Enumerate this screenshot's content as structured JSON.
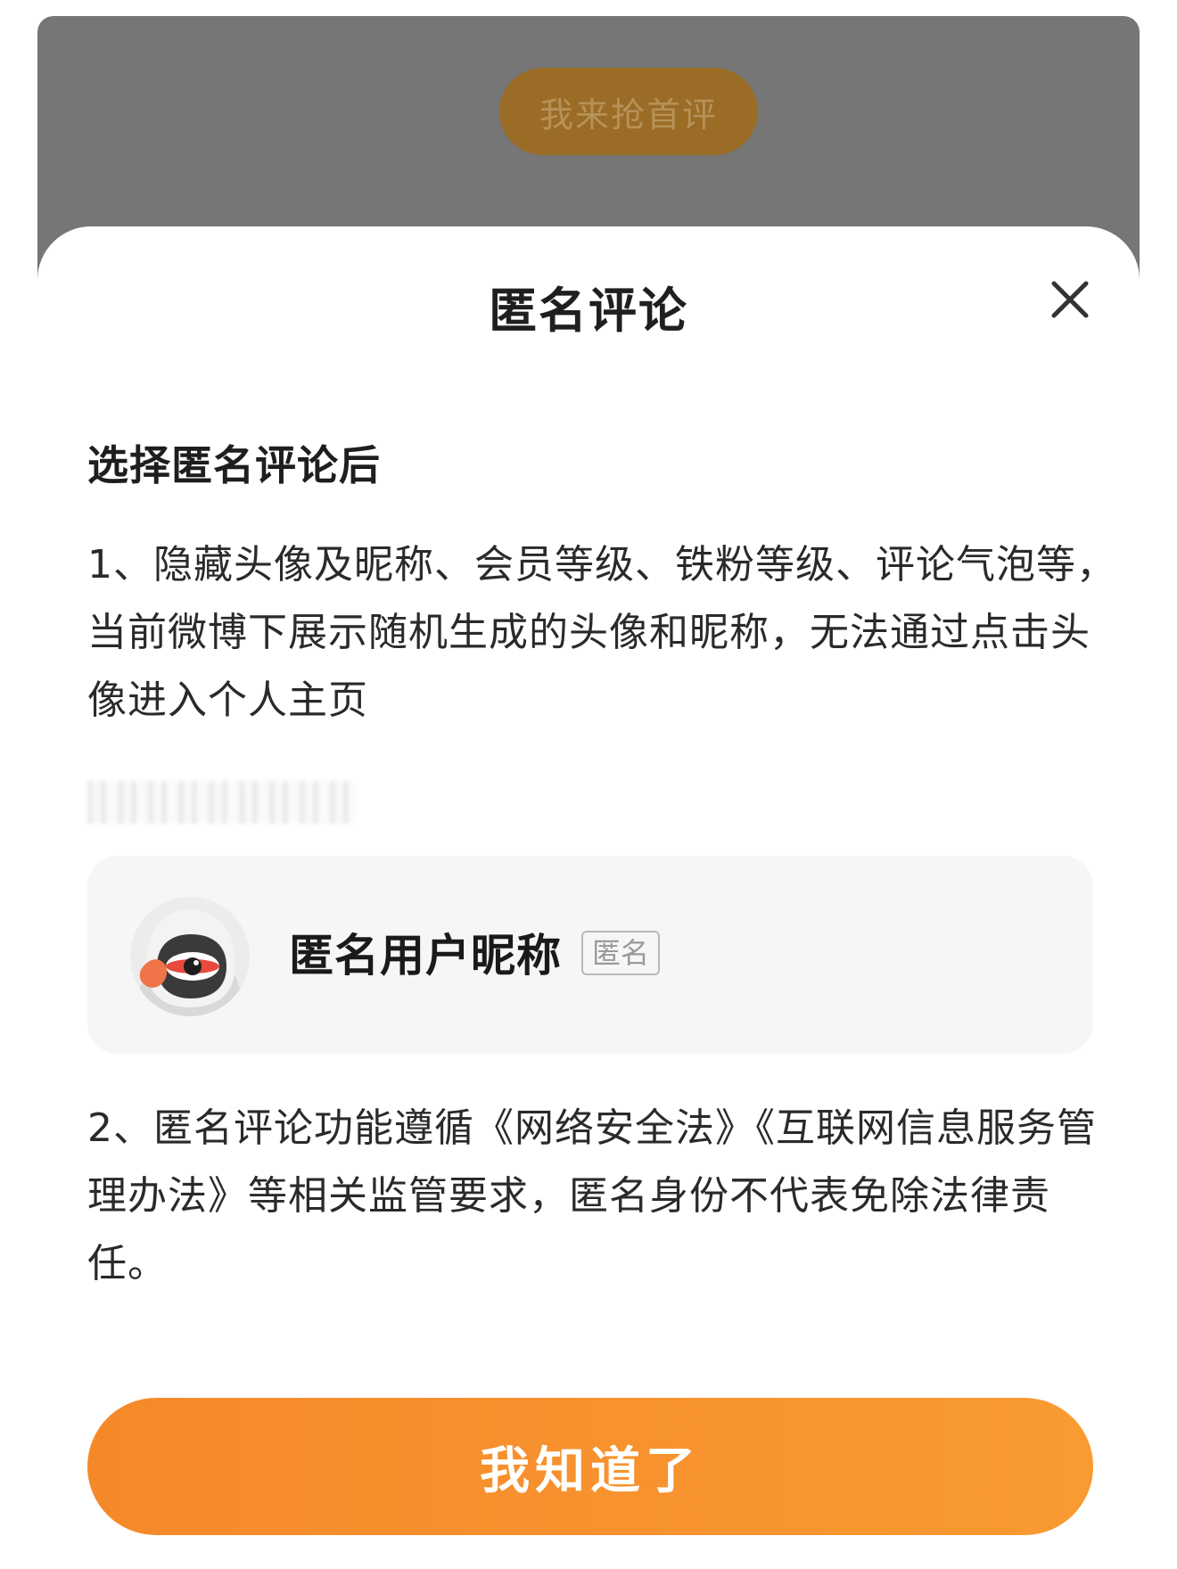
{
  "background": {
    "button_label": "我来抢首评"
  },
  "dialog": {
    "title": "匿名评论",
    "intro": "选择匿名评论后",
    "rule_1": "1、隐藏头像及昵称、会员等级、铁粉等级、评论气泡等，当前微博下展示随机生成的头像和昵称，无法通过点击头像进入个人主页",
    "preview": {
      "nickname": "匿名用户昵称",
      "badge": "匿名"
    },
    "rule_2": "2、匿名评论功能遵循《网络安全法》《互联网信息服务管理办法》等相关监管要求，匿名身份不代表免除法律责任。",
    "confirm_label": "我知道了"
  },
  "icons": {
    "close": "close-icon",
    "avatar": "anonymous-avatar-icon"
  },
  "colors": {
    "accent": "#f7902d",
    "backdrop": "#767676",
    "card": "#f6f6f6"
  }
}
